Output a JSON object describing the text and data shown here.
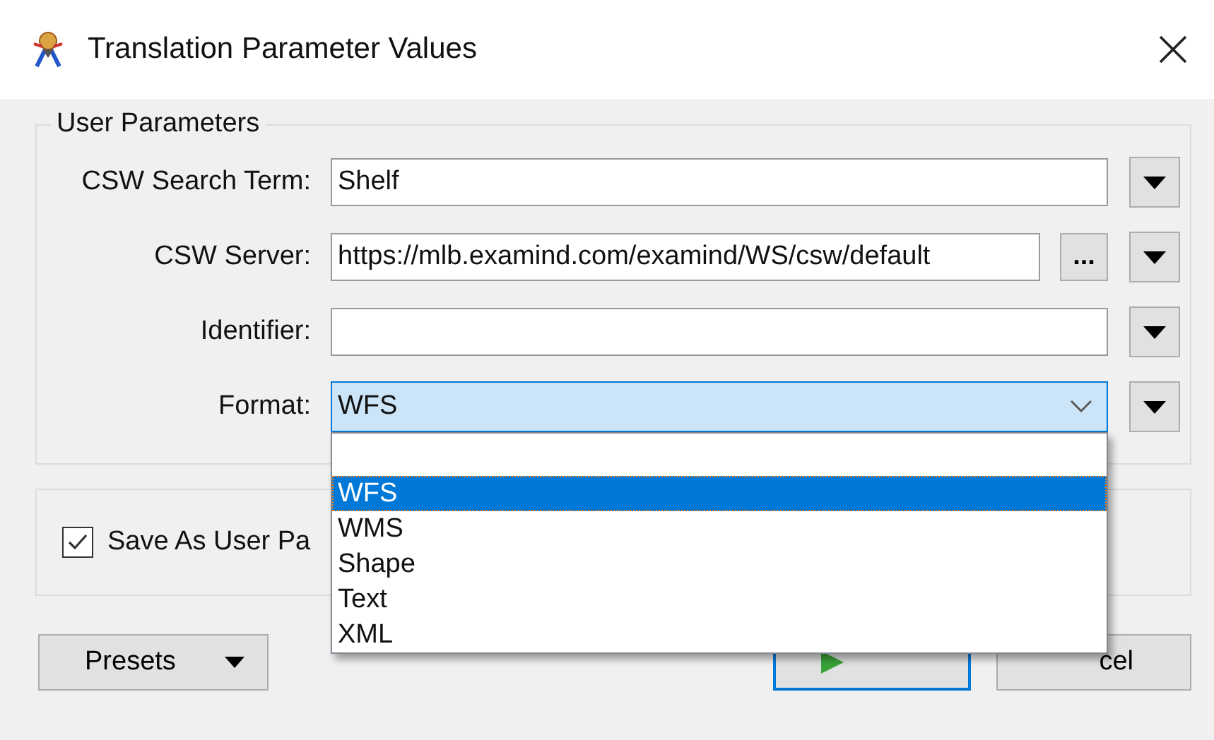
{
  "window": {
    "title": "Translation Parameter Values"
  },
  "user_parameters": {
    "title": "User Parameters",
    "fields": [
      {
        "kind": "text",
        "label": "CSW Search Term:",
        "value": "Shelf"
      },
      {
        "kind": "browse",
        "label": "CSW Server:",
        "value": "https://mlb.examind.com/examind/WS/csw/default",
        "browse": "..."
      },
      {
        "kind": "text",
        "label": "Identifier:"
      },
      {
        "kind": "combo",
        "label": "Format:",
        "value": "WFS",
        "expanded": true,
        "options": [
          {
            "kind": "blank"
          },
          {
            "kind": "item",
            "label": "WFS",
            "selected": true
          },
          {
            "kind": "item",
            "label": "WMS",
            "selected": false
          },
          {
            "kind": "item",
            "label": "Shape",
            "selected": false
          },
          {
            "kind": "item",
            "label": "Text",
            "selected": false
          },
          {
            "kind": "item",
            "label": "XML",
            "selected": false
          }
        ]
      }
    ]
  },
  "save_option": {
    "label": "Save As User Pa",
    "checked": true
  },
  "buttons": [
    {
      "kind": "presets",
      "label": "Presets"
    },
    {
      "kind": "run",
      "default": true
    },
    {
      "kind": "cancel",
      "label": "cel"
    }
  ]
}
